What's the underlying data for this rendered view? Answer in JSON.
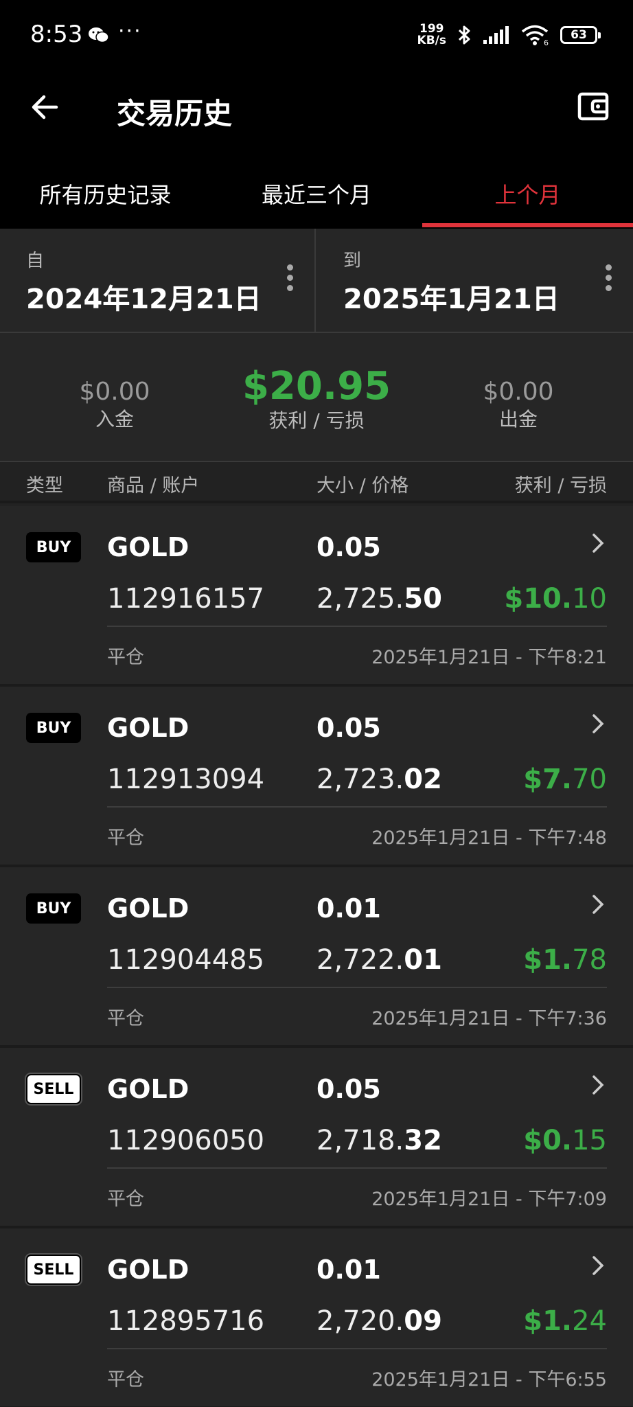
{
  "status_bar": {
    "time": "8:53",
    "dots": "···",
    "net_speed_top": "199",
    "net_speed_bottom": "KB/s",
    "battery": "63"
  },
  "header": {
    "title": "交易历史"
  },
  "tabs": [
    {
      "label": "所有历史记录",
      "active": false
    },
    {
      "label": "最近三个月",
      "active": false
    },
    {
      "label": "上个月",
      "active": true
    }
  ],
  "date_range": {
    "from_label": "自",
    "from_value": "2024年12月21日",
    "to_label": "到",
    "to_value": "2025年1月21日"
  },
  "summary": {
    "deposit_value": "$0.00",
    "deposit_label": "入金",
    "pl_value": "$20.95",
    "pl_label": "获利 / 亏损",
    "withdraw_value": "$0.00",
    "withdraw_label": "出金"
  },
  "columns": {
    "type": "类型",
    "symbol_account": "商品 / 账户",
    "size_price": "大小 / 价格",
    "pl": "获利 / 亏损"
  },
  "trades": [
    {
      "side": "BUY",
      "symbol": "GOLD",
      "size": "0.05",
      "account": "112916157",
      "price_main": "2,725.",
      "price_frac": "50",
      "pl_main": "$10.",
      "pl_frac": "10",
      "status": "平仓",
      "time": "2025年1月21日 - 下午8:21"
    },
    {
      "side": "BUY",
      "symbol": "GOLD",
      "size": "0.05",
      "account": "112913094",
      "price_main": "2,723.",
      "price_frac": "02",
      "pl_main": "$7.",
      "pl_frac": "70",
      "status": "平仓",
      "time": "2025年1月21日 - 下午7:48"
    },
    {
      "side": "BUY",
      "symbol": "GOLD",
      "size": "0.01",
      "account": "112904485",
      "price_main": "2,722.",
      "price_frac": "01",
      "pl_main": "$1.",
      "pl_frac": "78",
      "status": "平仓",
      "time": "2025年1月21日 - 下午7:36"
    },
    {
      "side": "SELL",
      "symbol": "GOLD",
      "size": "0.05",
      "account": "112906050",
      "price_main": "2,718.",
      "price_frac": "32",
      "pl_main": "$0.",
      "pl_frac": "15",
      "status": "平仓",
      "time": "2025年1月21日 - 下午7:09"
    },
    {
      "side": "SELL",
      "symbol": "GOLD",
      "size": "0.01",
      "account": "112895716",
      "price_main": "2,720.",
      "price_frac": "09",
      "pl_main": "$1.",
      "pl_frac": "24",
      "status": "平仓",
      "time": "2025年1月21日 - 下午6:55"
    }
  ],
  "colors": {
    "accent_red": "#e0333b",
    "profit_green": "#3cae48",
    "background": "#262626"
  },
  "icons": {
    "back": "arrow-left-icon",
    "wallet": "wallet-icon",
    "menu": "kebab-menu-icon",
    "row_open": "chevron-right-icon"
  }
}
